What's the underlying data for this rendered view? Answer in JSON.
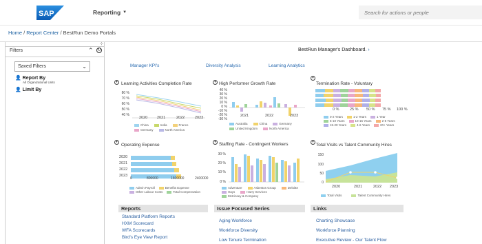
{
  "header": {
    "logo": "SAP",
    "menu_label": "Reporting",
    "search_placeholder": "Search for actions or people"
  },
  "breadcrumb": {
    "home": "Home",
    "sep1": " / ",
    "report_center": "Report Center",
    "sep2": " / ",
    "current": "BestRun Demo Portals"
  },
  "filters": {
    "title": "Filters",
    "saved_filters": "Saved Filters",
    "report_by": "Report By",
    "report_by_value": "All Organizational Units",
    "limit_by": "Limit By"
  },
  "dashboard": {
    "title": "BestRun Manager's Dashboard.",
    "nav_links": [
      "Manager KPI's",
      "Diversity Analysis",
      "Learning Analytics"
    ]
  },
  "cards": {
    "learning": {
      "title": "Learning Activities Completion Rate",
      "y_ticks": [
        "80 %",
        "70 %",
        "60 %",
        "50 %",
        "40 %"
      ],
      "x_ticks": [
        "2020",
        "2021",
        "2022",
        "2023"
      ],
      "legend": [
        "China",
        "India",
        "France",
        "Germany",
        "North America"
      ]
    },
    "high_performer": {
      "title": "High Performer Growth Rate",
      "y_ticks": [
        "40 %",
        "30 %",
        "20 %",
        "10 %",
        "0 %",
        "-10 %",
        "-20 %",
        "-30 %"
      ],
      "x_ticks": [
        "2021",
        "2022",
        "2023"
      ],
      "legend": [
        "Australia",
        "China",
        "Germany",
        "United Kingdom",
        "North America"
      ]
    },
    "termination": {
      "title": "Termination Rate - Voluntary",
      "x_ticks": [
        "0 %",
        "25 %",
        "50 %",
        "75 %",
        "100 %"
      ],
      "legend": [
        "0-2 Years",
        "1-2 Years",
        "1 Year",
        "5-10 Years",
        "10-15 Years",
        "2-5 Years",
        "15-20 Years",
        "4-6 Years",
        "20+ Years"
      ]
    },
    "opex": {
      "title": "Operating Expense",
      "y_ticks": [
        "2020",
        "2021",
        "2022",
        "2023"
      ],
      "x_ticks": [
        "0",
        "800000",
        "1600000",
        "2400000"
      ],
      "legend": [
        "Admin Payroll",
        "Benefits Expense",
        "Other Labour Costs",
        "Total Compensation"
      ]
    },
    "staffing": {
      "title": "Staffing Rate - Contingent Workers",
      "y_ticks": [
        "30 %",
        "20 %",
        "10 %",
        "0 %"
      ],
      "legend": [
        "Adventure",
        "Asbestos Group",
        "Deloitte",
        "Hays",
        "Harry Services",
        "McKinsey & Company"
      ]
    },
    "visits": {
      "title": "Total Visits vs Talent Community Hires",
      "y_ticks": [
        "150",
        "100",
        "50",
        "0"
      ],
      "x_ticks": [
        "2020",
        "2021",
        "2022",
        "2023"
      ],
      "legend": [
        "Total Visits",
        "Talent Community Hires"
      ]
    }
  },
  "sections": {
    "reports": {
      "title": "Reports",
      "items": [
        "Standard Platform Reports",
        "HXM Scorecard",
        "WFA Scorecards",
        "Bird's Eye View Report"
      ]
    },
    "issue": {
      "title": "Issue Focused Series",
      "items": [
        "Aging Workforce",
        "Workforce Diversity",
        "Low Tenure Termination"
      ]
    },
    "links": {
      "title": "Links",
      "items": [
        "Charting Showcase",
        "Workforce Planning",
        "Executive Review - Our Talent Flow"
      ]
    }
  },
  "colors": {
    "sap_blue": "#1a73c8",
    "link": "#2a6bb0",
    "bar_blue": "#7fc2e6",
    "bar_yellow": "#f4d35e",
    "area_blue": "#8fd0ef",
    "area_green": "#c7e39a"
  }
}
